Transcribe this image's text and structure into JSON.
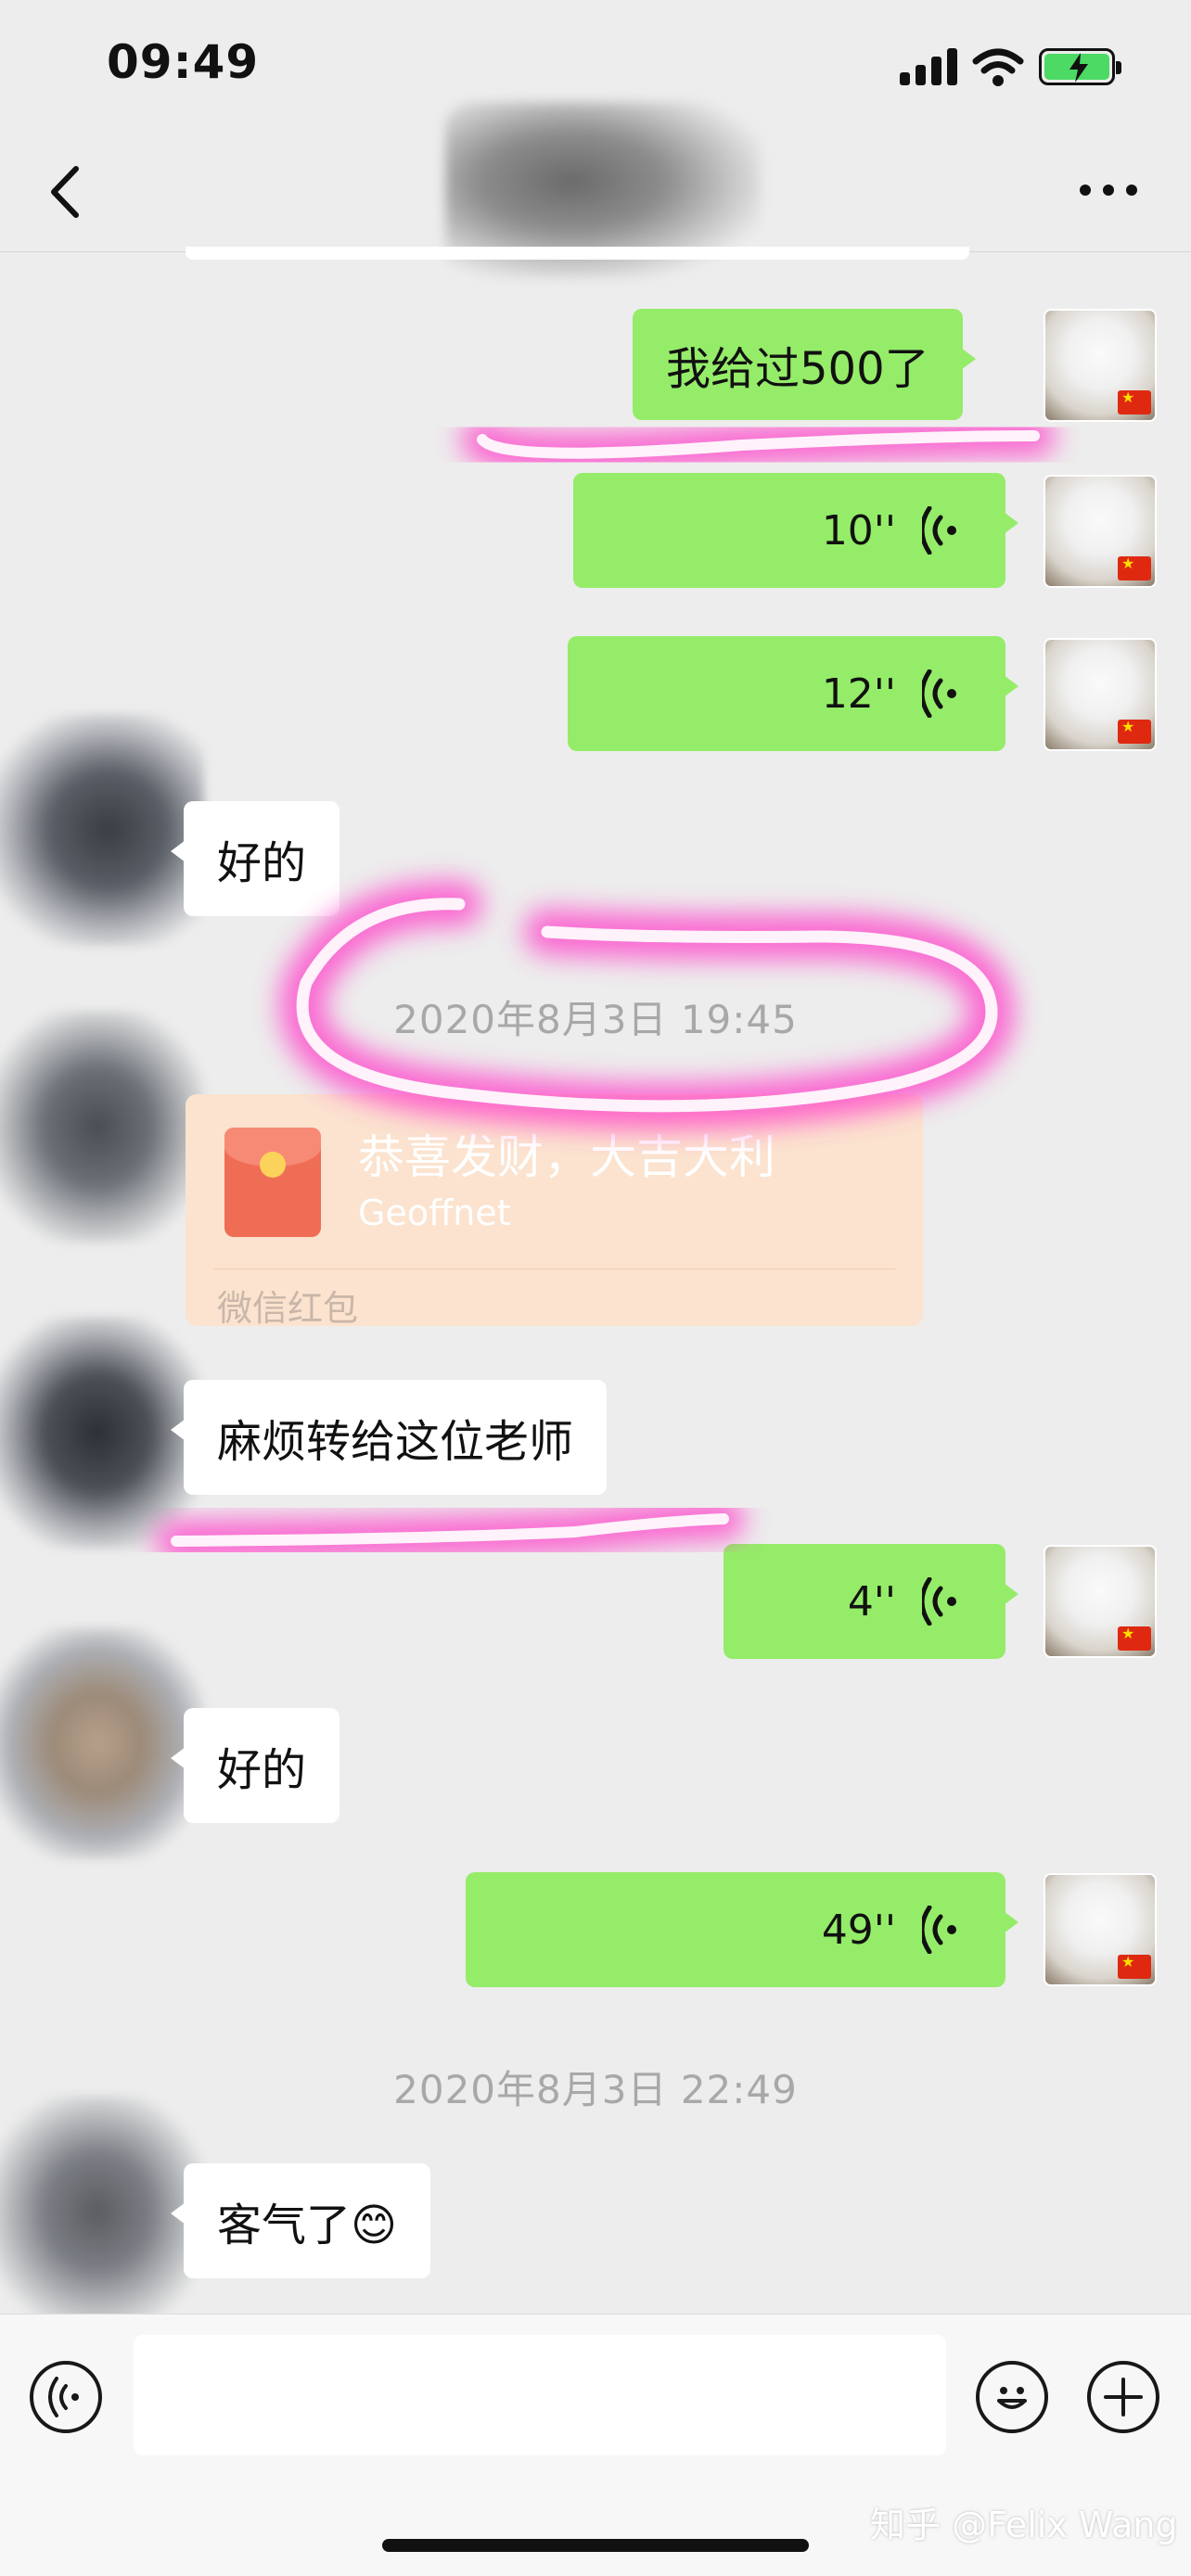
{
  "status_bar": {
    "time": "09:49"
  },
  "chat_messages": {
    "m1": "我给过500了",
    "m2_duration": "10''",
    "m3_duration": "12''",
    "m4": "好的",
    "ts1": "2020年8月3日 19:45",
    "red_packet": {
      "title": "恭喜发财，大吉大利",
      "sender": "Geoffnet",
      "label": "微信红包"
    },
    "m6": "麻烦转给这位老师",
    "m7_duration": "4''",
    "m8": "好的",
    "m9_duration": "49''",
    "ts2": "2020年8月3日 22:49",
    "m10": "客气了😊"
  },
  "watermark": "知乎 @Felix Wang",
  "colors": {
    "sent_bubble": "#95ec69",
    "received_bubble": "#ffffff",
    "background": "#ededed",
    "highlight": "#ff3cc8"
  }
}
